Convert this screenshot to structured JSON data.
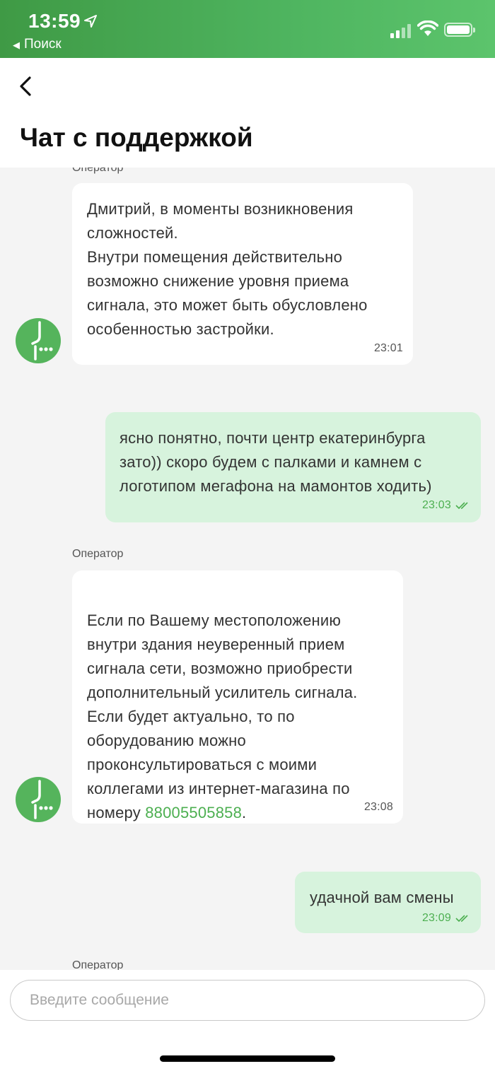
{
  "status_bar": {
    "time": "13:59",
    "back_app_label": "Поиск",
    "colors": {
      "gradient_start": "#3f9a45",
      "gradient_end": "#5cc46c"
    }
  },
  "header": {
    "title": "Чат с поддержкой",
    "back_icon": "chevron-left-icon"
  },
  "messages": [
    {
      "sender": "Оператор",
      "lines": "Дмитрий, в моменты возникновения\nсложностей.\nВнутри помещения действительно\nвозможно снижение уровня приема\nсигнала, это может быть обусловлено\nособенностью застройки.",
      "time": "23:01"
    },
    {
      "sender": "",
      "lines": "ясно понятно, почти центр екатеринбурга\nзато)) скоро будем с палками и камнем с\nлоготипом мегафона на мамонтов ходить)",
      "time": "23:03",
      "status_icon": "double-check-icon"
    },
    {
      "sender": "Оператор",
      "lines": "Если по Вашему местоположению\nвнутри здания неуверенный прием\nсигнала сети, возможно приобрести\nдополнительный усилитель сигнала.\nЕсли будет актуально, то по\nоборудованию можно\nпроконсультироваться с моими\nколлегами из интернет-магазина по",
      "last_line_prefix": "номеру ",
      "phone": "88005505858",
      "last_line_suffix": ".",
      "time": "23:08"
    },
    {
      "sender": "",
      "lines": "удачной вам смены",
      "time": "23:09",
      "status_icon": "double-check-icon"
    },
    {
      "sender": "Оператор"
    }
  ],
  "input": {
    "placeholder": "Введите сообщение",
    "value": ""
  },
  "colors": {
    "accent": "#4caf50",
    "outgoing_bubble": "#d7f3dd",
    "incoming_bubble": "#ffffff",
    "background": "#f4f4f4"
  }
}
